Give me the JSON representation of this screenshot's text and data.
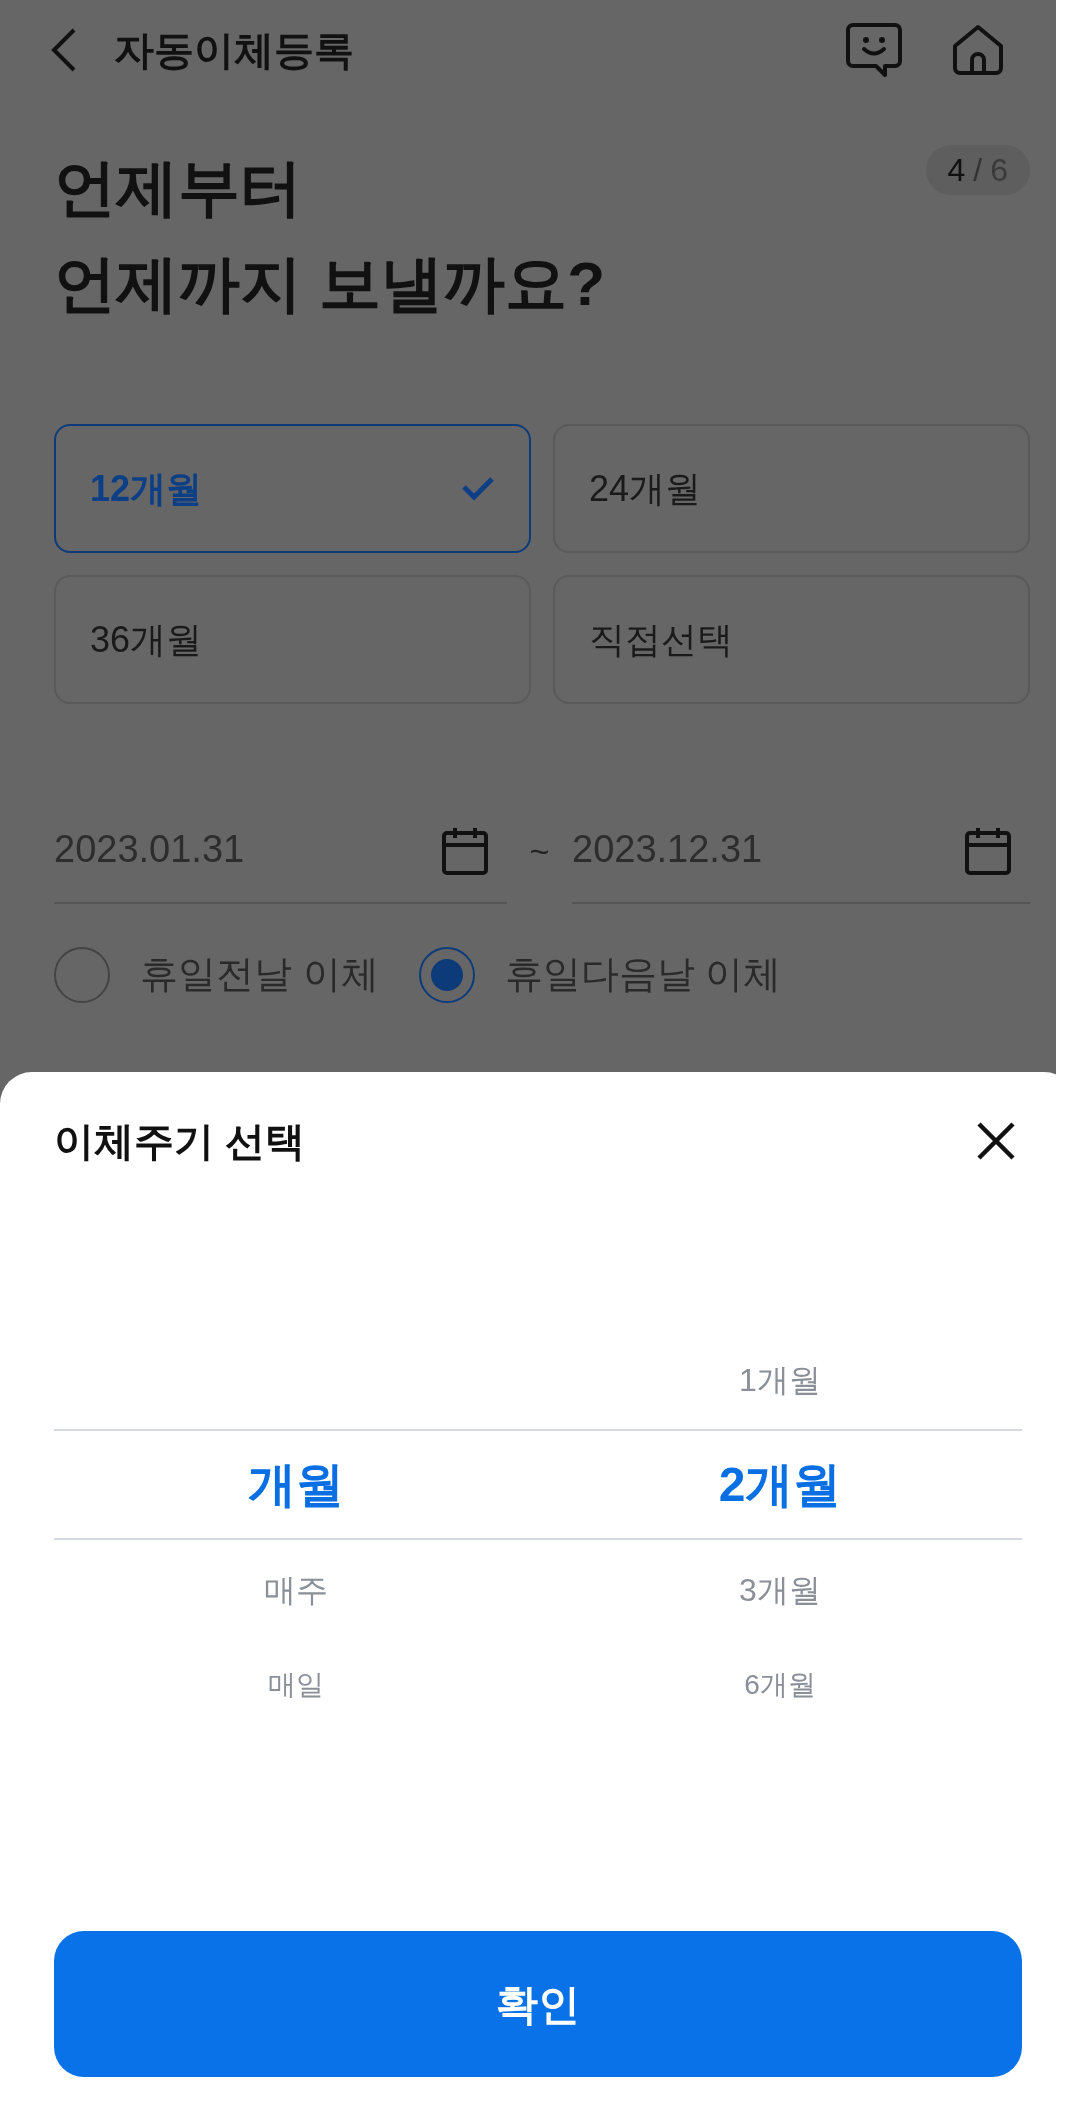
{
  "header": {
    "title": "자동이체등록"
  },
  "step": {
    "current": "4",
    "separator": "/",
    "total": "6"
  },
  "heading": [
    "언제부터",
    "언제까지 보낼까요?"
  ],
  "periods": [
    {
      "label": "12개월",
      "selected": true
    },
    {
      "label": "24개월",
      "selected": false
    },
    {
      "label": "36개월",
      "selected": false
    },
    {
      "label": "직접선택",
      "selected": false
    }
  ],
  "dates": {
    "start": "2023.01.31",
    "separator": "~",
    "end": "2023.12.31"
  },
  "holiday_options": [
    {
      "label": "휴일전날 이체",
      "selected": false
    },
    {
      "label": "휴일다음날 이체",
      "selected": true
    }
  ],
  "sheet": {
    "title": "이체주기 선택",
    "columns": [
      {
        "items": [
          {
            "label": "개월",
            "selected": true
          },
          {
            "label": "매주",
            "selected": false
          },
          {
            "label": "매일",
            "selected": false
          }
        ]
      },
      {
        "items": [
          {
            "label": "1개월",
            "selected": false
          },
          {
            "label": "2개월",
            "selected": true
          },
          {
            "label": "3개월",
            "selected": false
          },
          {
            "label": "6개월",
            "selected": false
          }
        ]
      }
    ],
    "confirm": "확인"
  }
}
